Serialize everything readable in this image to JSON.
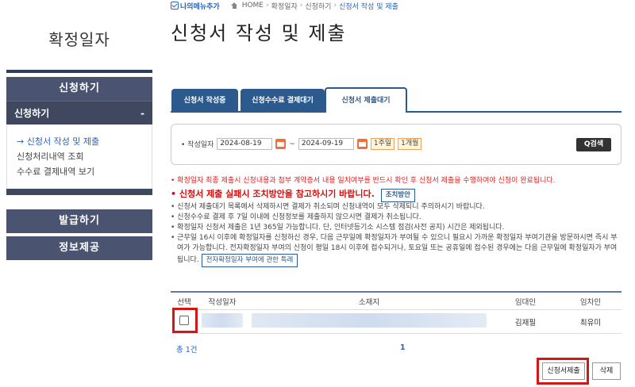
{
  "breadcrumb": {
    "mymenu": "나의메뉴추가",
    "items": [
      "HOME",
      "확정일자",
      "신청하기",
      "신청서 작성 및 제출"
    ]
  },
  "sidebar": {
    "title": "확정일자",
    "section1": "신청하기",
    "sub": "신청하기",
    "sub_toggle": "-",
    "links": [
      "→ 신청서 작성 및 제출",
      "신청처리내역 조회",
      "수수료 결제내역 보기"
    ],
    "section2": "발급하기",
    "section3": "정보제공"
  },
  "main": {
    "title": "신청서 작성 및 제출"
  },
  "tabs": [
    "신청서 작성중",
    "신청수수료 결제대기",
    "신청서 제출대기"
  ],
  "search": {
    "label": "작성일자",
    "date_from": "2024-08-19",
    "tilde": "~",
    "date_to": "2024-09-19",
    "period1": "1주일",
    "period2": "1개월",
    "button": "Q검색"
  },
  "notices": {
    "n1": "확정일자 최종 제출시 신청내용과 첨부 계약증서 내용 일치여부를 반드시 확인 후 신청서 제출을 수행하여야 신청이 완료됩니다.",
    "n2": "신청서 제출 실패시 조치방안을 참고하시기 바랍니다.",
    "n2_btn": "조치방안",
    "n3": "신청서 제출대기 목록에서 삭제하시면 결제가 취소되며 신청내역이 모두 삭제되니 주의하시기 바랍니다.",
    "n4": "신청수수료 결제 후 7일 이내에 신청정보를 제출하지 않으시면 결제가 취소됩니다.",
    "n5": "확정일자 신청서 제출은 1년 365일 가능합니다. 단, 인터넷등기소 시스템 점검(사전 공지) 시간은 제외됩니다.",
    "n6": "근무일 16시 이후에 확정일자를 신청하신 경우, 다음 근무일에 확정일자가 부여될 수 있으니 필요시 가까운 확정일자 부여기관을 방문하시면 즉시 부여가 가능합니다. 전자확정일자 부여의 신청이 평일 18시 이후에 접수되거나, 토요일 또는 공휴일에 접수된 경우에는 다음 근무일에 확정일자가 부여됩니다.",
    "n6_btn": "전자확정일자 부여에 관한 특례"
  },
  "table": {
    "headers": [
      "선택",
      "작성일자",
      "소재지",
      "임대인",
      "임차인"
    ],
    "rows": [
      {
        "landlord": "김재필",
        "tenant": "최유미"
      }
    ]
  },
  "footer": {
    "total": "총 1건",
    "page": "1",
    "submit_btn": "신청서제출",
    "delete_btn": "삭제"
  }
}
